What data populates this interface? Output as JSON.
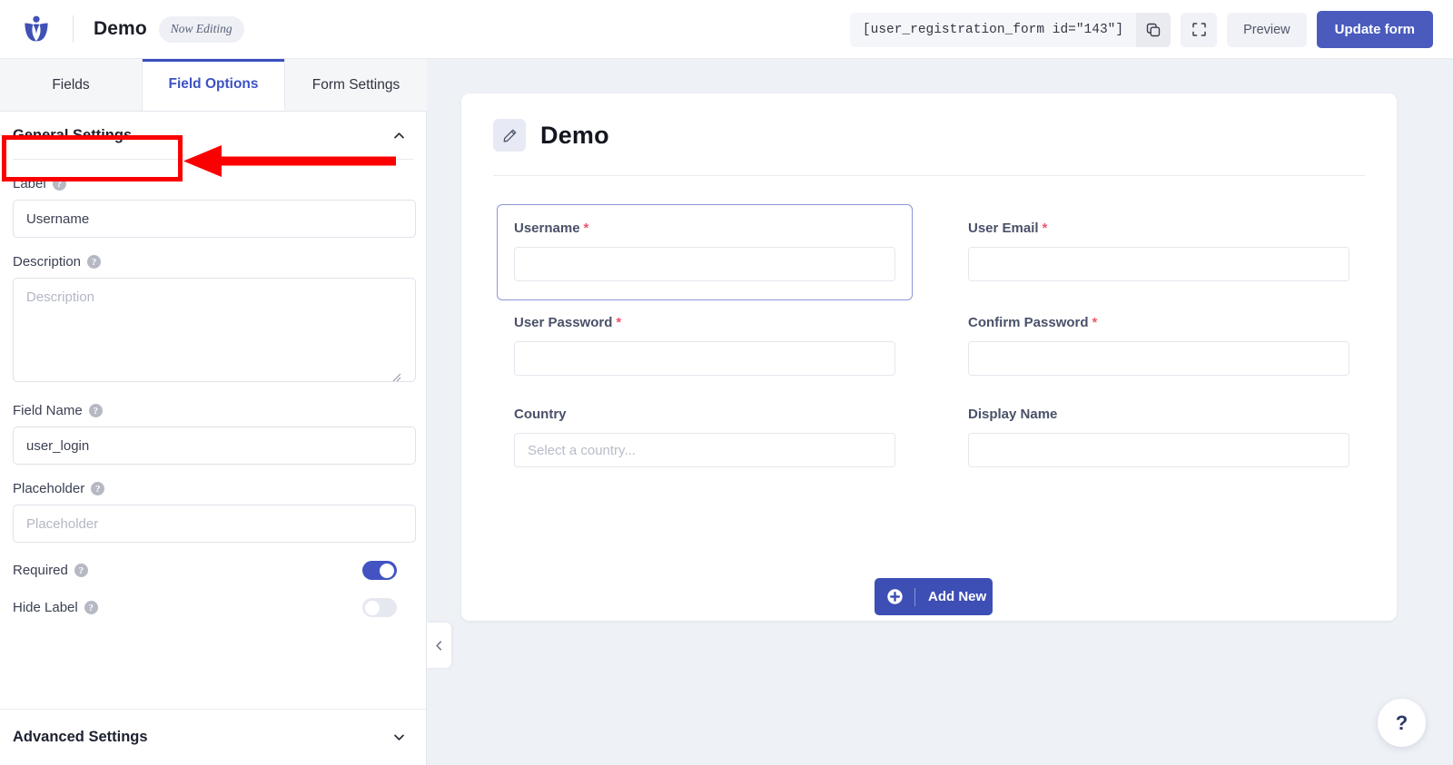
{
  "topbar": {
    "logo_icon": "user-registration-logo",
    "form_title": "Demo",
    "now_editing_badge": "Now Editing",
    "shortcode": "[user_registration_form id=\"143\"]",
    "copy_icon": "copy-icon",
    "fullscreen_icon": "fullscreen-icon",
    "preview_label": "Preview",
    "update_label": "Update form"
  },
  "tabs": [
    {
      "label": "Fields",
      "active": false
    },
    {
      "label": "Field Options",
      "active": true
    },
    {
      "label": "Form Settings",
      "active": false
    }
  ],
  "left_panel": {
    "general_settings": {
      "title": "General Settings",
      "chevron_icon": "chevron-up-icon",
      "expanded": true
    },
    "fields": {
      "label": {
        "label": "Label",
        "value": "Username",
        "help_icon": "help-icon"
      },
      "description": {
        "label": "Description",
        "placeholder": "Description",
        "value": "",
        "help_icon": "help-icon"
      },
      "field_name": {
        "label": "Field Name",
        "value": "user_login",
        "help_icon": "help-icon"
      },
      "placeholder": {
        "label": "Placeholder",
        "placeholder": "Placeholder",
        "value": "",
        "help_icon": "help-icon"
      },
      "required": {
        "label": "Required",
        "state": "on",
        "help_icon": "help-icon"
      },
      "hide_label": {
        "label": "Hide Label",
        "state": "off",
        "help_icon": "help-icon"
      }
    },
    "advanced_settings": {
      "title": "Advanced Settings",
      "chevron_icon": "chevron-down-icon",
      "expanded": false
    }
  },
  "canvas": {
    "card": {
      "edit_icon": "pencil-icon",
      "title": "Demo"
    },
    "form_fields": [
      {
        "label": "Username",
        "required": true,
        "required_mark": "*",
        "placeholder": "",
        "value": "",
        "selected": true
      },
      {
        "label": "User Email",
        "required": true,
        "required_mark": "*",
        "placeholder": "",
        "value": "",
        "selected": false
      },
      {
        "label": "User Password",
        "required": true,
        "required_mark": "*",
        "placeholder": "",
        "value": "",
        "selected": false
      },
      {
        "label": "Confirm Password",
        "required": true,
        "required_mark": "*",
        "placeholder": "",
        "value": "",
        "selected": false
      },
      {
        "label": "Country",
        "required": false,
        "required_mark": "",
        "placeholder": "Select a country...",
        "value": "",
        "selected": false
      },
      {
        "label": "Display Name",
        "required": false,
        "required_mark": "",
        "placeholder": "",
        "value": "",
        "selected": false
      }
    ],
    "add_new": {
      "label": "Add New",
      "icon": "plus-circle-icon"
    },
    "collapse_handle_icon": "chevron-left-icon",
    "help_fab_label": "?"
  },
  "annotation": {
    "box_target": "General Settings",
    "arrow_icon": "left-arrow-annotation",
    "color": "#fb0000"
  }
}
